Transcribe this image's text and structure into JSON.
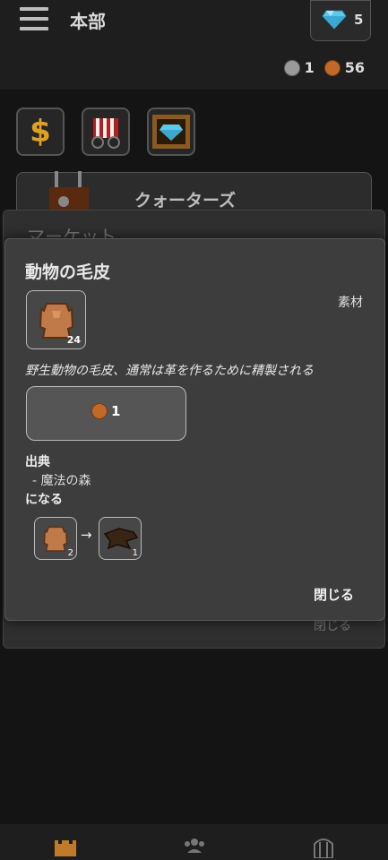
{
  "header": {
    "title": "本部",
    "gem_count": "5",
    "silver_count": "1",
    "copper_count": "56"
  },
  "quick_buttons": {
    "shop_symbol": "$"
  },
  "background": {
    "building_label": "クォーターズ",
    "market_label": "マーケット",
    "close_label": "閉じる"
  },
  "item_modal": {
    "title": "動物の毛皮",
    "quantity": "24",
    "category": "素材",
    "description": "野生動物の毛皮、通常は革を作るために精製される",
    "price": "1",
    "source_heading": "出典",
    "source_location": "- 魔法の森",
    "becomes_heading": "になる",
    "recipe": {
      "input_qty": "2",
      "arrow": "→",
      "output_qty": "1"
    },
    "close_label": "閉じる"
  },
  "colors": {
    "copper": "#c06a2a",
    "gem": "#5fc8e8",
    "fur": "#c07a4a"
  }
}
